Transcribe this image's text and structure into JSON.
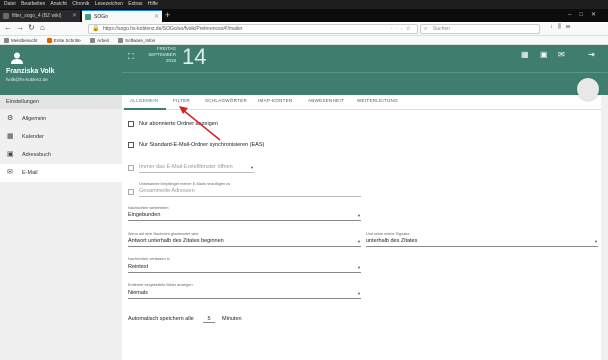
{
  "browser": {
    "menu": [
      "Datei",
      "Bearbeiten",
      "Ansicht",
      "Chronik",
      "Lesezeichen",
      "Extras",
      "Hilfe"
    ],
    "tabs": [
      {
        "title": "filter_sogo_4 (BZ wiki)",
        "favicon_color": "#6a6a6a",
        "active": false
      },
      {
        "title": "SOGo",
        "favicon_color": "#3f9f7f",
        "active": true
      }
    ],
    "url": "https://sogo.hs-koblenz.de/SOGo/so/fvolk/Preferences#!/mailer",
    "search_placeholder": "Suchen",
    "bookmarks": [
      {
        "label": "Meistbesucht",
        "color": "#888"
      },
      {
        "label": "Erste Schritte",
        "color": "#e66000"
      },
      {
        "label": "Arbeit",
        "color": "#888"
      },
      {
        "label": "Software_Infos",
        "color": "#888"
      }
    ]
  },
  "user": {
    "name": "Franziska Volk",
    "email": "fvolk@hs-koblenz.de"
  },
  "header": {
    "day_name": "FREITAG",
    "month_year": "SEPTEMBER 2018",
    "day_number": "14",
    "accent": "#3f7e6e"
  },
  "sidebar": {
    "heading": "Einstellungen",
    "items": [
      {
        "label": "Allgemein",
        "icon": "gear-icon"
      },
      {
        "label": "Kalender",
        "icon": "calendar-icon"
      },
      {
        "label": "Adressbuch",
        "icon": "contacts-icon"
      },
      {
        "label": "E-Mail",
        "icon": "mail-icon",
        "active": true
      }
    ]
  },
  "pref_tabs": [
    "ALLGEMEIN",
    "FILTER",
    "SCHLAGWÖRTER",
    "IMAP-KONTEN",
    "ABWESENHEIT",
    "WEITERLEITUNG"
  ],
  "settings": {
    "cb_subscribed": "Nur abonnierte Ordner anzeigen",
    "cb_standard": "Nur Standard-E-Mail-Ordner synchronisieren (EAS)",
    "open_editor": "Immer das E-Mail-Erstellfenster öffnen",
    "unknown_recipients_label": "Unbekannte Empfänger meiner E-Mails hinzufügen zu",
    "unknown_recipients_value": "Gesammelte Adressen",
    "forward_label": "Nachrichten weiterleiten",
    "forward_value": "Eingebunden",
    "reply_label": "Wenn auf eine Nachricht geantwortet wird",
    "reply_value": "Antwort unterhalb des Zitates beginnen",
    "signature_label": "Und setze meine Signatur",
    "signature_value": "unterhalb des Zitates",
    "compose_label": "Nachrichten verfassen in",
    "compose_value": "Reintext",
    "images_label": "Entfernte eingebettete Bilder anzeigen",
    "images_value": "Niemals",
    "autosave_prefix": "Automatisch speichern alle",
    "autosave_value": "5",
    "autosave_suffix": "Minuten"
  }
}
